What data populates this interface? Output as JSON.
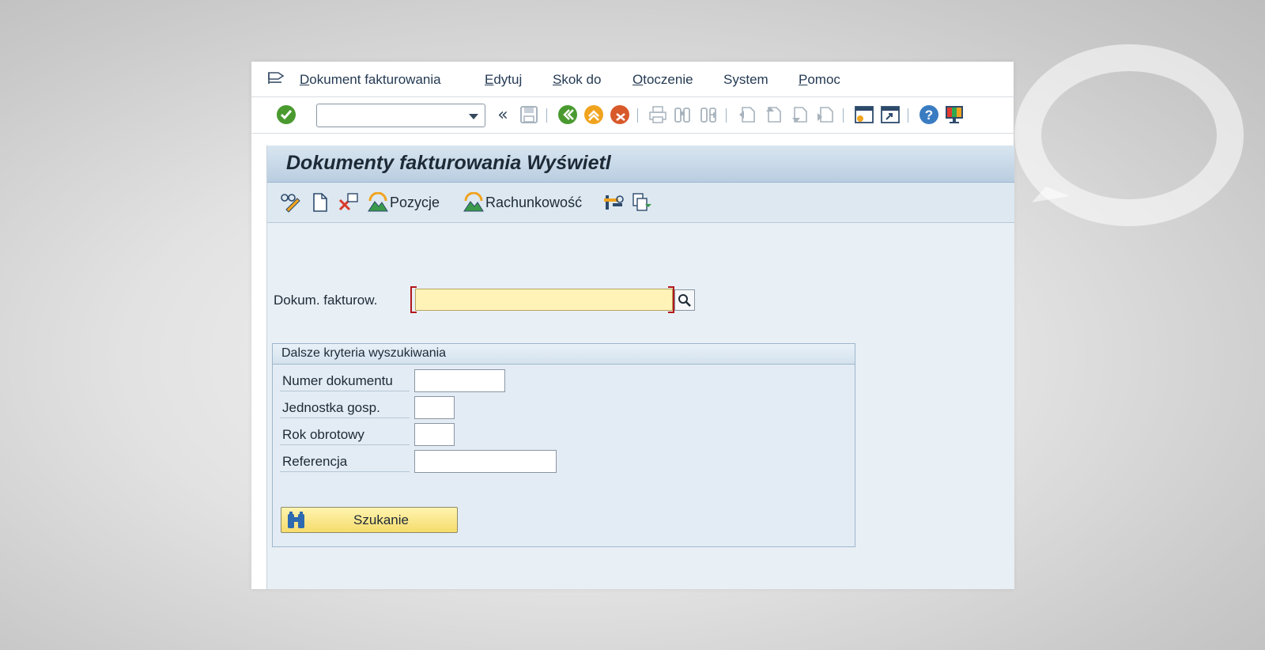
{
  "menu": {
    "items": [
      {
        "underline": "D",
        "rest": "okument fakturowania"
      },
      {
        "underline": "E",
        "rest": "dytuj"
      },
      {
        "underline": "S",
        "rest": "kok do"
      },
      {
        "underline": "O",
        "rest": "toczenie"
      },
      {
        "underline": "Sy",
        "rest": "stem"
      },
      {
        "underline": "P",
        "rest": "omoc"
      }
    ]
  },
  "toolbar": {
    "command_field_value": "",
    "icons": [
      "enter-check-icon",
      "command-field",
      "collapse-icon",
      "save-icon",
      "back-icon",
      "exit-icon",
      "cancel-icon",
      "print-icon",
      "find-icon",
      "find-next-icon",
      "first-page-icon",
      "previous-page-icon",
      "next-page-icon",
      "last-page-icon",
      "new-session-icon",
      "shortcut-icon",
      "help-icon",
      "customize-layout-icon"
    ]
  },
  "screen": {
    "title": "Dokumenty fakturowania Wyświetl"
  },
  "app_toolbar": {
    "items_label": "Pozycje",
    "accounting_label": "Rachunkowość"
  },
  "form": {
    "billing_doc_label": "Dokum. fakturow.",
    "billing_doc_value": ""
  },
  "group": {
    "title": "Dalsze kryteria wyszukiwania",
    "fields": [
      {
        "label": "Numer dokumentu",
        "value": ""
      },
      {
        "label": "Jednostka gosp.",
        "value": ""
      },
      {
        "label": "Rok obrotowy",
        "value": ""
      },
      {
        "label": "Referencja",
        "value": ""
      }
    ],
    "search_button": "Szukanie"
  },
  "colors": {
    "required_field": "#fff3b8",
    "title_bar": "#c6d7e7",
    "content_bg": "#e8eff5"
  }
}
